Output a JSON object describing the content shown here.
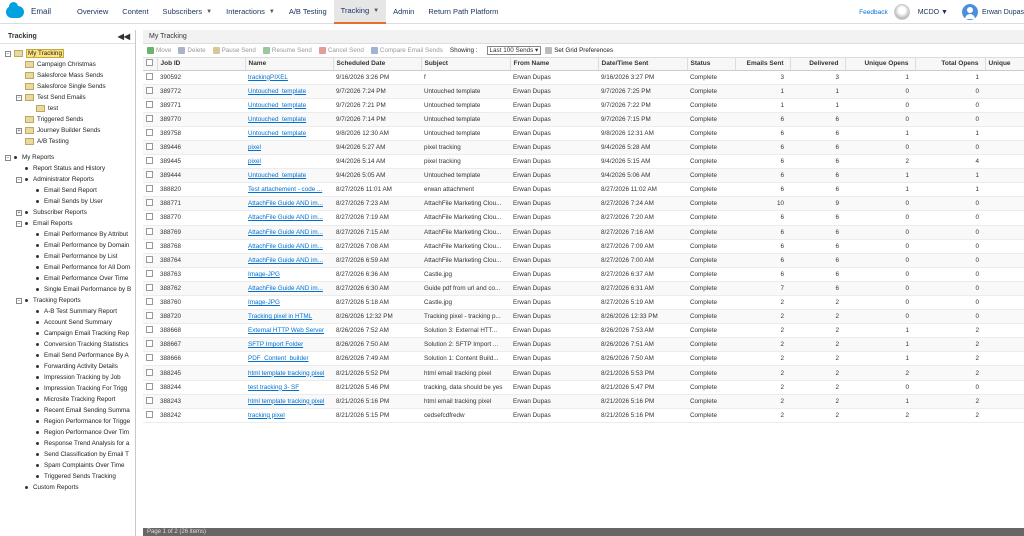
{
  "brand": {
    "name": "Email"
  },
  "nav": {
    "items": [
      {
        "label": "Overview"
      },
      {
        "label": "Content"
      },
      {
        "label": "Subscribers",
        "caret": "▼"
      },
      {
        "label": "Interactions",
        "caret": "▼"
      },
      {
        "label": "A/B Testing"
      },
      {
        "label": "Tracking",
        "caret": "▼",
        "active": true
      },
      {
        "label": "Admin"
      },
      {
        "label": "Return Path Platform"
      }
    ],
    "feedback": "Feedback",
    "business_unit": "MCDO ▼",
    "user_name": "Erwan Dupas"
  },
  "left": {
    "title": "Tracking",
    "collapse_glyph": "◀◀",
    "tree": [
      {
        "label": "My Tracking",
        "level": 0,
        "kind": "folder",
        "exp": "−",
        "selected": true
      },
      {
        "label": "Campaign Christmas",
        "level": 1,
        "kind": "folder"
      },
      {
        "label": "Salesforce Mass Sends",
        "level": 1,
        "kind": "folder"
      },
      {
        "label": "Salesforce Single Sends",
        "level": 1,
        "kind": "folder"
      },
      {
        "label": "Test Send Emails",
        "level": 1,
        "kind": "folder",
        "exp": "−"
      },
      {
        "label": "test",
        "level": 2,
        "kind": "folder"
      },
      {
        "label": "Triggered Sends",
        "level": 1,
        "kind": "folder"
      },
      {
        "label": "Journey Builder Sends",
        "level": 1,
        "kind": "folder",
        "exp": "+"
      },
      {
        "label": "A/B Testing",
        "level": 1,
        "kind": "folder"
      },
      {
        "label": "",
        "level": 0,
        "kind": "spacer"
      },
      {
        "label": "My Reports",
        "level": 0,
        "kind": "bullet",
        "exp": "−"
      },
      {
        "label": "Report Status and History",
        "level": 1,
        "kind": "bullet"
      },
      {
        "label": "Administrator Reports",
        "level": 1,
        "kind": "bullet",
        "exp": "−"
      },
      {
        "label": "Email Send Report",
        "level": 2,
        "kind": "bullet"
      },
      {
        "label": "Email Sends by User",
        "level": 2,
        "kind": "bullet"
      },
      {
        "label": "Subscriber Reports",
        "level": 1,
        "kind": "bullet",
        "exp": "+"
      },
      {
        "label": "Email Reports",
        "level": 1,
        "kind": "bullet",
        "exp": "−"
      },
      {
        "label": "Email Performance By Attribut",
        "level": 2,
        "kind": "bullet"
      },
      {
        "label": "Email Performance by Domain",
        "level": 2,
        "kind": "bullet"
      },
      {
        "label": "Email Performance by List",
        "level": 2,
        "kind": "bullet"
      },
      {
        "label": "Email Performance for All Dom",
        "level": 2,
        "kind": "bullet"
      },
      {
        "label": "Email Performance Over Time",
        "level": 2,
        "kind": "bullet"
      },
      {
        "label": "Single Email Performance by B",
        "level": 2,
        "kind": "bullet"
      },
      {
        "label": "Tracking Reports",
        "level": 1,
        "kind": "bullet",
        "exp": "−"
      },
      {
        "label": "A-B Test Summary Report",
        "level": 2,
        "kind": "bullet"
      },
      {
        "label": "Account Send Summary",
        "level": 2,
        "kind": "bullet"
      },
      {
        "label": "Campaign Email Tracking Rep",
        "level": 2,
        "kind": "bullet"
      },
      {
        "label": "Conversion Tracking Statistics",
        "level": 2,
        "kind": "bullet"
      },
      {
        "label": "Email Send Performance By A",
        "level": 2,
        "kind": "bullet"
      },
      {
        "label": "Forwarding Activity Details",
        "level": 2,
        "kind": "bullet"
      },
      {
        "label": "Impression Tracking by Job",
        "level": 2,
        "kind": "bullet"
      },
      {
        "label": "Impression Tracking For Trigg",
        "level": 2,
        "kind": "bullet"
      },
      {
        "label": "Microsite Tracking Report",
        "level": 2,
        "kind": "bullet"
      },
      {
        "label": "Recent Email Sending Summa",
        "level": 2,
        "kind": "bullet"
      },
      {
        "label": "Region Performance for Trigge",
        "level": 2,
        "kind": "bullet"
      },
      {
        "label": "Region Performance Over Tim",
        "level": 2,
        "kind": "bullet"
      },
      {
        "label": "Response Trend Analysis for a",
        "level": 2,
        "kind": "bullet"
      },
      {
        "label": "Send Classification by Email T",
        "level": 2,
        "kind": "bullet"
      },
      {
        "label": "Spam Complaints Over Time",
        "level": 2,
        "kind": "bullet"
      },
      {
        "label": "Triggered Sends Tracking",
        "level": 2,
        "kind": "bullet"
      },
      {
        "label": "Custom Reports",
        "level": 1,
        "kind": "bullet"
      }
    ]
  },
  "main": {
    "title": "My Tracking",
    "toolbar": {
      "move": "Move",
      "delete": "Delete",
      "pause": "Pause Send",
      "resume": "Resume Send",
      "cancel": "Cancel Send",
      "compare": "Compare Email Sends",
      "showing_label": "Showing :",
      "showing_value": "Last 100 Sends ▾",
      "grid_prefs": "Set Grid Preferences"
    },
    "columns": [
      "",
      "Job ID",
      "Name",
      "Scheduled Date",
      "Subject",
      "From Name",
      "Date/Time Sent",
      "Status",
      "Emails Sent",
      "Delivered",
      "Unique Opens",
      "Total Opens",
      "Unique"
    ],
    "rows": [
      [
        "390592",
        "trackingPIXEL",
        "9/16/2026 3:26 PM",
        "f",
        "Erwan Dupas",
        "9/16/2026 3:27 PM",
        "Complete",
        "3",
        "3",
        "1",
        "1"
      ],
      [
        "389772",
        "Untouched_template",
        "9/7/2026 7:24 PM",
        "Untouched template",
        "Erwan Dupas",
        "9/7/2026 7:25 PM",
        "Complete",
        "1",
        "1",
        "0",
        "0"
      ],
      [
        "389771",
        "Untouched_template",
        "9/7/2026 7:21 PM",
        "Untouched template",
        "Erwan Dupas",
        "9/7/2026 7:22 PM",
        "Complete",
        "1",
        "1",
        "0",
        "0"
      ],
      [
        "389770",
        "Untouched_template",
        "9/7/2026 7:14 PM",
        "Untouched template",
        "Erwan Dupas",
        "9/7/2026 7:15 PM",
        "Complete",
        "6",
        "6",
        "0",
        "0"
      ],
      [
        "389758",
        "Untouched_template",
        "9/8/2026 12:30 AM",
        "Untouched template",
        "Erwan Dupas",
        "9/8/2026 12:31 AM",
        "Complete",
        "6",
        "6",
        "1",
        "1"
      ],
      [
        "389446",
        "pixel",
        "9/4/2026 5:27 AM",
        "pixel tracking",
        "Erwan Dupas",
        "9/4/2026 5:28 AM",
        "Complete",
        "6",
        "6",
        "0",
        "0"
      ],
      [
        "389445",
        "pixel",
        "9/4/2026 5:14 AM",
        "pixel tracking",
        "Erwan Dupas",
        "9/4/2026 5:15 AM",
        "Complete",
        "6",
        "6",
        "2",
        "4"
      ],
      [
        "389444",
        "Untouched_template",
        "9/4/2026 5:05 AM",
        "Untouched template",
        "Erwan Dupas",
        "9/4/2026 5:06 AM",
        "Complete",
        "6",
        "6",
        "1",
        "1"
      ],
      [
        "388820",
        "Test attachement - code ...",
        "8/27/2026 11:01 AM",
        "erwan attachment",
        "Erwan Dupas",
        "8/27/2026 11:02 AM",
        "Complete",
        "6",
        "6",
        "1",
        "1"
      ],
      [
        "388771",
        "AttachFile Guide AND im...",
        "8/27/2026 7:23 AM",
        "AttachFile Marketing Clou...",
        "Erwan Dupas",
        "8/27/2026 7:24 AM",
        "Complete",
        "10",
        "9",
        "0",
        "0"
      ],
      [
        "388770",
        "AttachFile Guide AND im...",
        "8/27/2026 7:19 AM",
        "AttachFile Marketing Clou...",
        "Erwan Dupas",
        "8/27/2026 7:20 AM",
        "Complete",
        "6",
        "6",
        "0",
        "0"
      ],
      [
        "388769",
        "AttachFile Guide AND im...",
        "8/27/2026 7:15 AM",
        "AttachFile Marketing Clou...",
        "Erwan Dupas",
        "8/27/2026 7:16 AM",
        "Complete",
        "6",
        "6",
        "0",
        "0"
      ],
      [
        "388768",
        "AttachFile Guide AND im...",
        "8/27/2026 7:08 AM",
        "AttachFile Marketing Clou...",
        "Erwan Dupas",
        "8/27/2026 7:09 AM",
        "Complete",
        "6",
        "6",
        "0",
        "0"
      ],
      [
        "388764",
        "AttachFile Guide AND im...",
        "8/27/2026 6:59 AM",
        "AttachFile Marketing Clou...",
        "Erwan Dupas",
        "8/27/2026 7:00 AM",
        "Complete",
        "6",
        "6",
        "0",
        "0"
      ],
      [
        "388763",
        "Image-JPG",
        "8/27/2026 6:36 AM",
        "Castle.jpg",
        "Erwan Dupas",
        "8/27/2026 6:37 AM",
        "Complete",
        "6",
        "6",
        "0",
        "0"
      ],
      [
        "388762",
        "AttachFile Guide AND im...",
        "8/27/2026 6:30 AM",
        "Guide pdf from url and co...",
        "Erwan Dupas",
        "8/27/2026 6:31 AM",
        "Complete",
        "7",
        "6",
        "0",
        "0"
      ],
      [
        "388760",
        "Image-JPG",
        "8/27/2026 5:18 AM",
        "Castle.jpg",
        "Erwan Dupas",
        "8/27/2026 5:19 AM",
        "Complete",
        "2",
        "2",
        "0",
        "0"
      ],
      [
        "388720",
        "Tracking pixel in HTML",
        "8/26/2026 12:32 PM",
        "Tracking pixel - tracking p...",
        "Erwan Dupas",
        "8/26/2026 12:33 PM",
        "Complete",
        "2",
        "2",
        "0",
        "0"
      ],
      [
        "388668",
        "External HTTP Web Server",
        "8/26/2026 7:52 AM",
        "Solution 3: External HTT...",
        "Erwan Dupas",
        "8/26/2026 7:53 AM",
        "Complete",
        "2",
        "2",
        "1",
        "2"
      ],
      [
        "388667",
        "SFTP Import Folder",
        "8/26/2026 7:50 AM",
        "Solution 2: SFTP Import ...",
        "Erwan Dupas",
        "8/26/2026 7:51 AM",
        "Complete",
        "2",
        "2",
        "1",
        "2"
      ],
      [
        "388666",
        "PDF_Content_builder",
        "8/26/2026 7:49 AM",
        "Solution 1: Content Build...",
        "Erwan Dupas",
        "8/26/2026 7:50 AM",
        "Complete",
        "2",
        "2",
        "1",
        "2"
      ],
      [
        "388245",
        "html template tracking pixel",
        "8/21/2026 5:52 PM",
        "html email tracking pixel",
        "Erwan Dupas",
        "8/21/2026 5:53 PM",
        "Complete",
        "2",
        "2",
        "2",
        "2"
      ],
      [
        "388244",
        "test tracking 3- SF",
        "8/21/2026 5:46 PM",
        "tracking, data should be yes",
        "Erwan Dupas",
        "8/21/2026 5:47 PM",
        "Complete",
        "2",
        "2",
        "0",
        "0"
      ],
      [
        "388243",
        "html template tracking pixel",
        "8/21/2026 5:16 PM",
        "html email tracking pixel",
        "Erwan Dupas",
        "8/21/2026 5:16 PM",
        "Complete",
        "2",
        "2",
        "1",
        "2"
      ],
      [
        "388242",
        "tracking pixel",
        "8/21/2026 5:15 PM",
        "cedsefcdfredw",
        "Erwan Dupas",
        "8/21/2026 5:16 PM",
        "Complete",
        "2",
        "2",
        "2",
        "2"
      ]
    ],
    "status_bar": "Page 1 of 2 (26 items)"
  }
}
